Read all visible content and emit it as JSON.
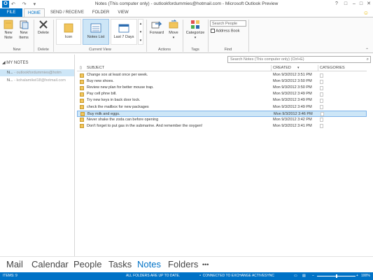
{
  "window": {
    "title": "Notes (This computer only) - outlookfordummies@hotmail.com - Microsoft Outlook Preview",
    "app_icon_letter": "O",
    "controls": [
      "?",
      "□",
      "–",
      "□",
      "✕"
    ]
  },
  "ribbon_tabs": [
    {
      "label": "FILE"
    },
    {
      "label": "HOME",
      "active": true
    },
    {
      "label": "SEND / RECEIVE"
    },
    {
      "label": "FOLDER"
    },
    {
      "label": "VIEW"
    }
  ],
  "ribbon": {
    "new_note_label": "New Note",
    "new_items_label": "New Items",
    "delete_label": "Delete",
    "view_icon": "Icon",
    "view_notes_list": "Notes List",
    "view_last7": "Last 7 Days",
    "forward_label": "Forward",
    "move_label": "Move",
    "categorize_label": "Categorize",
    "search_people_placeholder": "Search People",
    "address_book_label": "Address Book",
    "groups": {
      "new": "New",
      "delete": "Delete",
      "current_view": "Current View",
      "actions": "Actions",
      "tags": "Tags",
      "find": "Find"
    }
  },
  "search": {
    "placeholder": "Search Notes (This computer only) (Ctrl+E)"
  },
  "sidebar": {
    "header": "MY NOTES",
    "folders": [
      {
        "name": "N...",
        "account": " - outlookfordummies@hotm",
        "selected": true
      },
      {
        "name": "N...",
        "account": " - kohalamikel18@hotmail.com",
        "selected": false
      }
    ]
  },
  "columns": {
    "subject": "SUBJECT",
    "created": "CREATED",
    "categories": "CATEGORIES"
  },
  "notes": [
    {
      "subject": "Change sox at least once per week.",
      "created": "Mon 9/3/2012 3:51 PM"
    },
    {
      "subject": "Buy new shoes.",
      "created": "Mon 9/3/2012 3:50 PM"
    },
    {
      "subject": "Review new plan for better mouse trap.",
      "created": "Mon 9/3/2012 3:50 PM"
    },
    {
      "subject": "Pay cell phne bill.",
      "created": "Mon 9/3/2012 3:49 PM"
    },
    {
      "subject": "Try new keys in back door lock.",
      "created": "Mon 9/3/2012 3:49 PM"
    },
    {
      "subject": "check the mailbox for new packages",
      "created": "Mon 9/3/2012 3:49 PM"
    },
    {
      "subject": "Buy milk and eggs.",
      "created": "Mon 9/3/2012 3:46 PM",
      "selected": true
    },
    {
      "subject": "Never shake the zoda can before opening",
      "created": "Mon 9/3/2012 3:42 PM"
    },
    {
      "subject": "Don't forget to put gas in the submarine.  And remember the oxygen!",
      "created": "Mon 9/3/2012 3:41 PM"
    }
  ],
  "nav": {
    "items": [
      "Mail",
      "Calendar",
      "People",
      "Tasks",
      "Notes",
      "Folders",
      "•••"
    ],
    "active": "Notes"
  },
  "status": {
    "items": "ITEMS: 9",
    "folders": "ALL FOLDERS ARE UP TO DATE.",
    "connection": "CONNECTED TO EXCHANGE ACTIVESYNC",
    "zoom": "100%"
  },
  "colors": {
    "accent": "#0072c6",
    "selection": "#cde6f7",
    "note_icon": "#f2c55c"
  }
}
